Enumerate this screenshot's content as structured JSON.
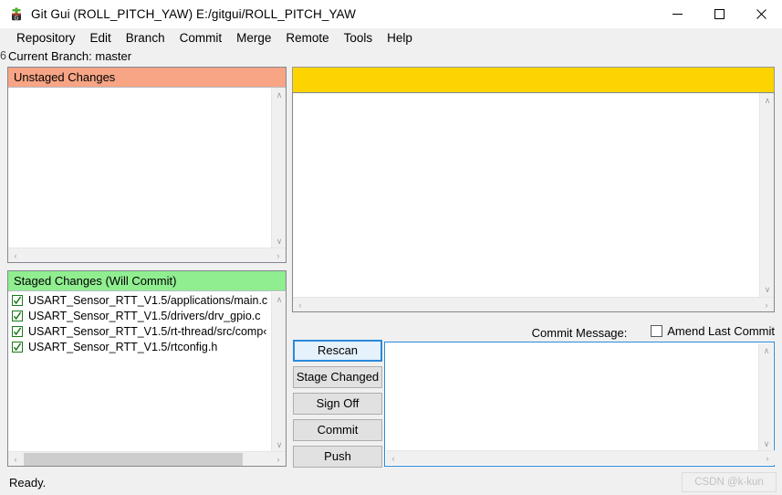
{
  "window": {
    "title": "Git Gui (ROLL_PITCH_YAW) E:/gitgui/ROLL_PITCH_YAW",
    "icon": "git-gui-icon",
    "controls": {
      "minimize": "—",
      "maximize": "☐",
      "close": "✕"
    }
  },
  "menubar": {
    "items": [
      {
        "label": "Repository"
      },
      {
        "label": "Edit"
      },
      {
        "label": "Branch"
      },
      {
        "label": "Commit"
      },
      {
        "label": "Merge"
      },
      {
        "label": "Remote"
      },
      {
        "label": "Tools"
      },
      {
        "label": "Help"
      }
    ]
  },
  "branch_row": {
    "clipped_prefix": "6",
    "label": "Current Branch: master"
  },
  "unstaged": {
    "header": "Unstaged Changes",
    "header_color": "#f7a585",
    "files": []
  },
  "staged": {
    "header": "Staged Changes (Will Commit)",
    "header_color": "#90ee90",
    "files": [
      {
        "checked": true,
        "path": "USART_Sensor_RTT_V1.5/applications/main.c"
      },
      {
        "checked": true,
        "path": "USART_Sensor_RTT_V1.5/drivers/drv_gpio.c"
      },
      {
        "checked": true,
        "path": "USART_Sensor_RTT_V1.5/rt-thread/src/comp‹"
      },
      {
        "checked": true,
        "path": "USART_Sensor_RTT_V1.5/rtconfig.h"
      }
    ]
  },
  "diff": {
    "header_color": "#fdd300",
    "header_text": "",
    "body_text": ""
  },
  "buttons": [
    {
      "label": "Rescan",
      "focused": true
    },
    {
      "label": "Stage Changed",
      "focused": false
    },
    {
      "label": "Sign Off",
      "focused": false
    },
    {
      "label": "Commit",
      "focused": false
    },
    {
      "label": "Push",
      "focused": false
    }
  ],
  "commit": {
    "title": "Commit Message:",
    "amend_label": "Amend Last Commit",
    "amend_checked": false,
    "message_value": ""
  },
  "statusbar": {
    "text": "Ready.",
    "watermark": "CSDN @k-kun"
  },
  "scroll_arrows": {
    "up": "∧",
    "down": "∨",
    "left": "‹",
    "right": "›"
  }
}
